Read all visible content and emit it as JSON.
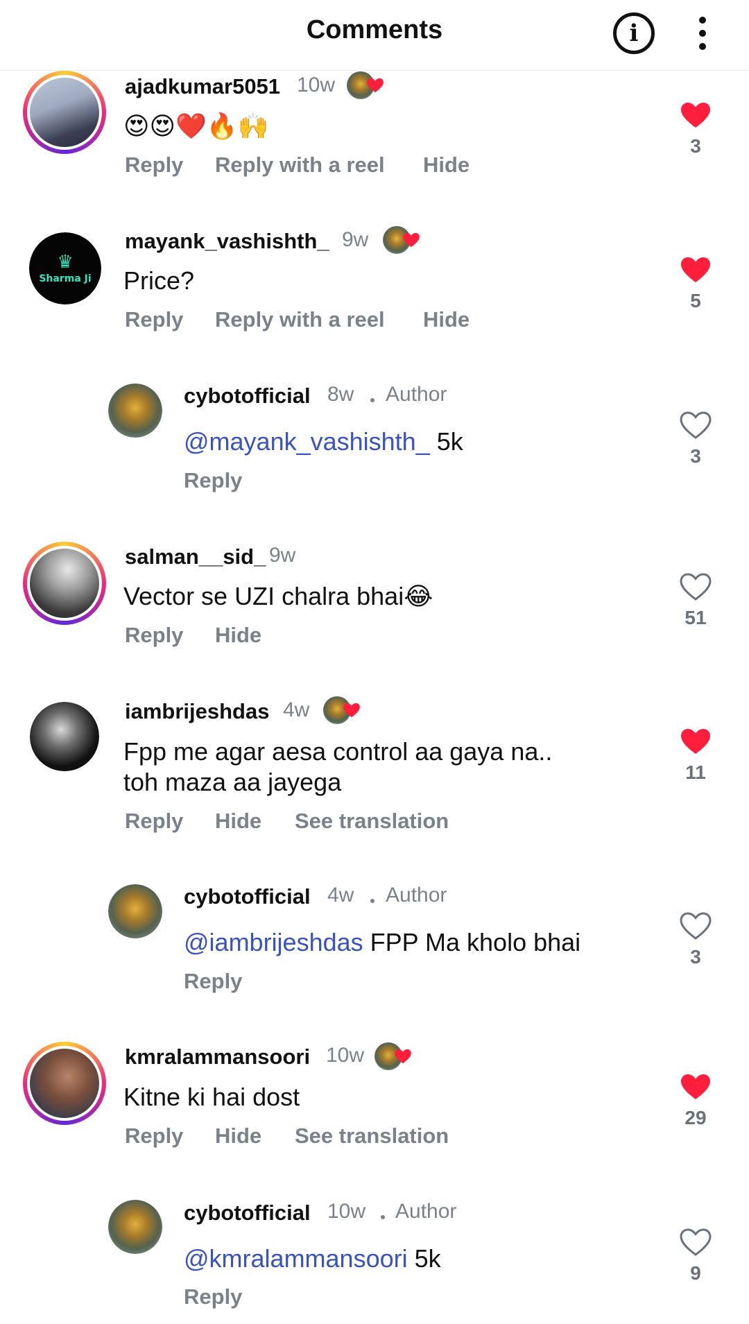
{
  "header": {
    "title": "Comments",
    "info_icon": "info-icon",
    "more_icon": "more-vertical-icon"
  },
  "colors": {
    "mention": "#3852c4",
    "like_red": "#ff1f3d",
    "muted": "#7b818a"
  },
  "labels": {
    "reply": "Reply",
    "reply_with_reel": "Reply with a reel",
    "hide": "Hide",
    "see_translation": "See translation",
    "author": "Author"
  },
  "comments": [
    {
      "username": "ajadkumar5051",
      "time": "10w",
      "creator_liked": true,
      "text": "😍😍❤️🔥🙌",
      "likes": "3",
      "liked": true
    },
    {
      "username": "mayank_vashishth_",
      "time": "9w",
      "creator_liked": true,
      "avatar_text": "Sharma Ji",
      "text": "Price?",
      "likes": "5",
      "liked": true
    },
    {
      "username": "cybotofficial",
      "time": "8w",
      "is_author": true,
      "mention": "@mayank_vashishth_",
      "text": " 5k",
      "likes": "3",
      "liked": false
    },
    {
      "username": "salman__sid_",
      "time": "9w",
      "text": "Vector se UZI chalra bhai😂",
      "likes": "51",
      "liked": false
    },
    {
      "username": "iambrijeshdas",
      "time": "4w",
      "creator_liked": true,
      "text_line1": "Fpp me agar aesa control aa gaya na..",
      "text_line2": "toh maza aa jayega",
      "likes": "11",
      "liked": true
    },
    {
      "username": "cybotofficial",
      "time": "4w",
      "is_author": true,
      "mention": "@iambrijeshdas",
      "text": " FPP Ma kholo bhai",
      "likes": "3",
      "liked": false
    },
    {
      "username": "kmralammansoori",
      "time": "10w",
      "creator_liked": true,
      "text": "Kitne ki hai dost",
      "likes": "29",
      "liked": true
    },
    {
      "username": "cybotofficial",
      "time": "10w",
      "is_author": true,
      "mention": "@kmralammansoori",
      "text": " 5k",
      "likes": "9",
      "liked": false
    }
  ]
}
